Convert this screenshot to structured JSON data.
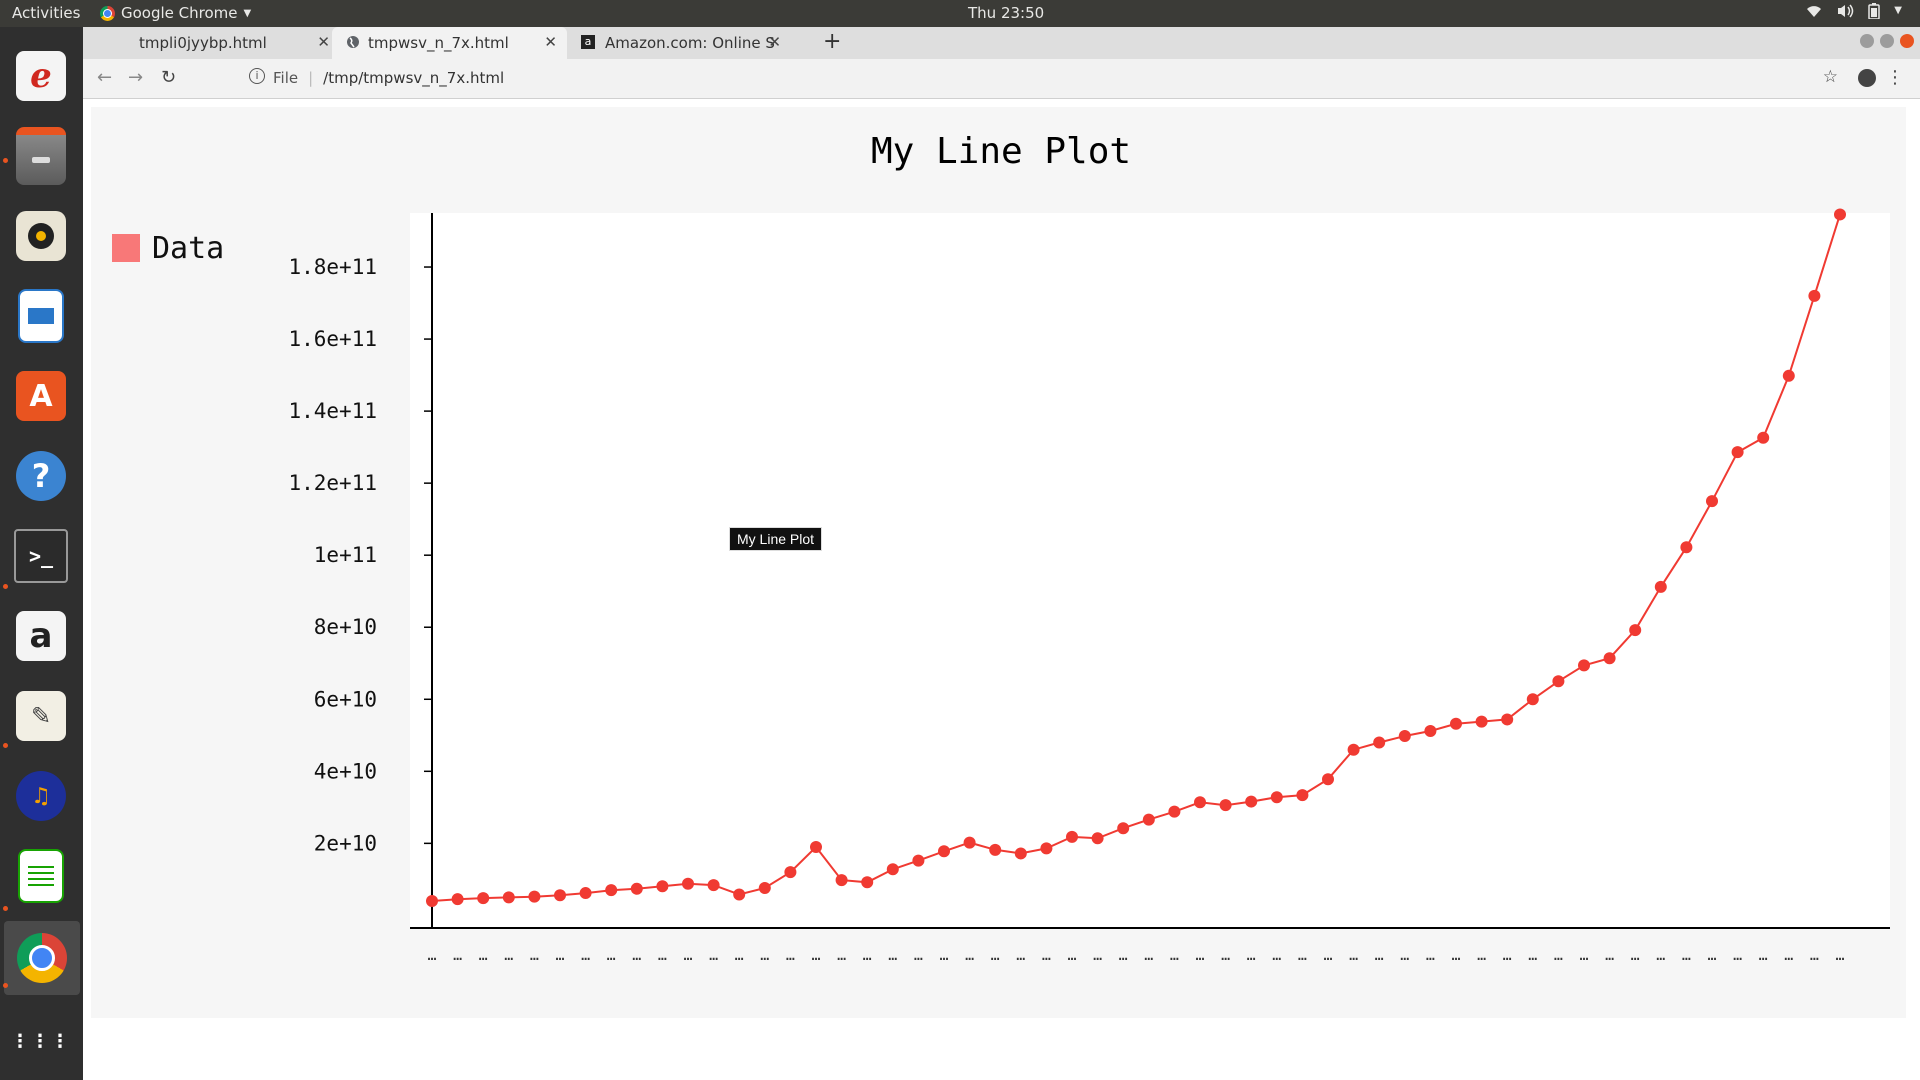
{
  "topbar": {
    "activities": "Activities",
    "app_name": "Google Chrome",
    "clock": "Thu 23:50",
    "tray_icons": [
      "wifi-icon",
      "volume-icon",
      "battery-icon",
      "chevron-down-icon"
    ]
  },
  "dock": {
    "apps": [
      "evince-icon",
      "files-icon",
      "rhythmbox-icon",
      "writer-icon",
      "software-center-icon",
      "help-icon",
      "terminal-icon",
      "amazon-icon",
      "text-editor-icon",
      "audacity-icon",
      "calc-icon",
      "chrome-icon",
      "app-grid-icon"
    ]
  },
  "browser": {
    "tabs": [
      {
        "title": "tmpli0jyybp.html"
      },
      {
        "title": "tmpwsv_n_7x.html"
      },
      {
        "title": "Amazon.com: Online Shop"
      }
    ],
    "new_tab": "+",
    "url_scheme": "File",
    "url": "/tmp/tmpwsv_n_7x.html"
  },
  "tooltip": "My Line Plot",
  "chart_data": {
    "type": "line",
    "title": "My Line Plot",
    "legend": {
      "position": "top-left"
    },
    "series": [
      {
        "name": "Data",
        "color": "#f03a32",
        "legend_color": "#f87878",
        "values": [
          4000000000.0,
          4500000000.0,
          4800000000.0,
          5000000000.0,
          5200000000.0,
          5600000000.0,
          6200000000.0,
          7000000000.0,
          7400000000.0,
          8100000000.0,
          8800000000.0,
          8400000000.0,
          5800000000.0,
          7600000000.0,
          12000000000.0,
          19000000000.0,
          9800000000.0,
          9200000000.0,
          12800000000.0,
          15200000000.0,
          17800000000.0,
          20200000000.0,
          18200000000.0,
          17200000000.0,
          18600000000.0,
          21800000000.0,
          21400000000.0,
          24200000000.0,
          26600000000.0,
          28800000000.0,
          31400000000.0,
          30600000000.0,
          31600000000.0,
          32800000000.0,
          33400000000.0,
          37800000000.0,
          46000000000.0,
          48000000000.0,
          49800000000.0,
          51200000000.0,
          53200000000.0,
          53800000000.0,
          54400000000.0,
          60000000000.0,
          65000000000.0,
          69400000000.0,
          71400000000.0,
          79200000000.0,
          91200000000.0,
          102200000000.0,
          115000000000.0,
          128600000000.0,
          132600000000.0,
          149800000000.0,
          172000000000.0,
          194600000000.0
        ]
      }
    ],
    "x_tick_label": "…",
    "yticks": [
      {
        "value": 20000000000,
        "label": "2e+10"
      },
      {
        "value": 40000000000,
        "label": "4e+10"
      },
      {
        "value": 60000000000,
        "label": "6e+10"
      },
      {
        "value": 80000000000,
        "label": "8e+10"
      },
      {
        "value": 100000000000,
        "label": "1e+11"
      },
      {
        "value": 120000000000,
        "label": "1.2e+11"
      },
      {
        "value": 140000000000,
        "label": "1.4e+11"
      },
      {
        "value": 160000000000,
        "label": "1.6e+11"
      },
      {
        "value": 180000000000,
        "label": "1.8e+11"
      }
    ],
    "ylim": [
      -3500000000,
      195000000000
    ],
    "grid": "horizontal dashed",
    "emphasized_gridline": 100000000000
  }
}
